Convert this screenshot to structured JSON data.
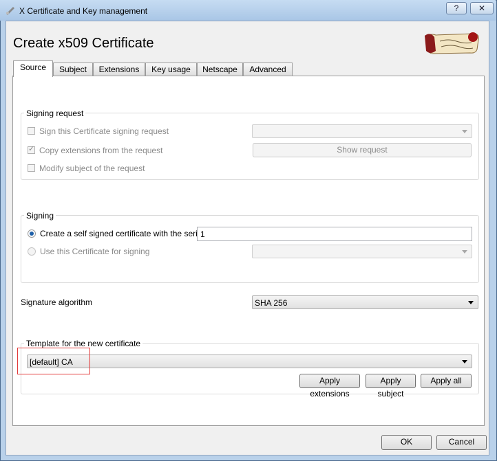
{
  "window": {
    "title": "X Certificate and Key management",
    "help_glyph": "?",
    "close_glyph": "✕"
  },
  "page_title": "Create x509 Certificate",
  "tabs": [
    {
      "label": "Source",
      "active": true
    },
    {
      "label": "Subject"
    },
    {
      "label": "Extensions"
    },
    {
      "label": "Key usage"
    },
    {
      "label": "Netscape"
    },
    {
      "label": "Advanced"
    }
  ],
  "signing_request": {
    "group_title": "Signing request",
    "sign_csr_label": "Sign this Certificate signing request",
    "copy_ext_label": "Copy extensions from the request",
    "modify_subject_label": "Modify subject of the request",
    "csr_select_value": "",
    "show_request_label": "Show request"
  },
  "signing": {
    "group_title": "Signing",
    "self_signed_label": "Create a self signed certificate with the serial",
    "serial_value": "1",
    "use_cert_label": "Use this Certificate for signing",
    "cert_select_value": ""
  },
  "signature_algorithm": {
    "label": "Signature algorithm",
    "value": "SHA 256"
  },
  "template": {
    "group_title": "Template for the new certificate",
    "value": "[default] CA",
    "apply_extensions_label": "Apply extensions",
    "apply_subject_label": "Apply subject",
    "apply_all_label": "Apply all"
  },
  "footer": {
    "ok_label": "OK",
    "cancel_label": "Cancel"
  },
  "colors": {
    "selection_highlight": "#e23b3b",
    "radio_selected": "#1d5fa8"
  }
}
